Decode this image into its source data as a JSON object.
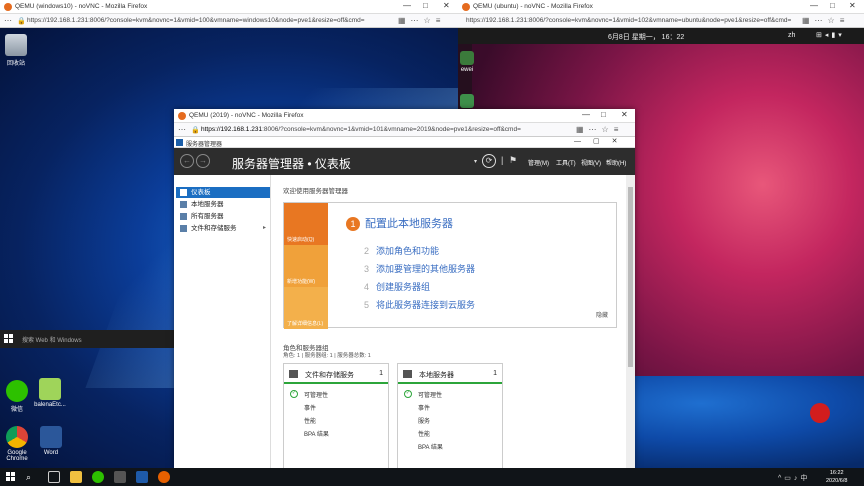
{
  "left_browser": {
    "title": "QEMU (windows10) - noVNC - Mozilla Firefox",
    "url": "https://192.168.1.231:8006/?console=kvm&novnc=1&vmid=100&vmname=windows10&node=pve1&resize=off&cmd="
  },
  "right_browser": {
    "title": "QEMU (ubuntu) - noVNC - Mozilla Firefox",
    "url": "https://192.168.1.231:8006/?console=kvm&novnc=1&vmid=102&vmname=ubuntu&node=pve1&resize=off&cmd="
  },
  "front_browser": {
    "title": "QEMU (2019) - noVNC - Mozilla Firefox",
    "url_host": "https://192.168.1.231",
    "url_rest": ":8006/?console=kvm&novnc=1&vmid=101&vmname=2019&node=pve1&resize=off&cmd="
  },
  "server_manager": {
    "window_title": "服务器管理器",
    "header_title": "服务器管理器 • 仪表板",
    "menus": {
      "manage": "管理(M)",
      "tools": "工具(T)",
      "view": "视图(V)",
      "help": "帮助(H)"
    },
    "nav": [
      {
        "label": "仪表板"
      },
      {
        "label": "本地服务器"
      },
      {
        "label": "所有服务器"
      },
      {
        "label": "文件和存储服务",
        "arrow": "▸"
      }
    ],
    "welcome": "欢迎使用服务器管理器",
    "tiles": [
      "快速启动(Q)",
      "新增功能(W)",
      "了解详细信息(L)"
    ],
    "step1": {
      "num": "1",
      "label": "配置此本地服务器"
    },
    "steps": [
      {
        "num": "2",
        "label": "添加角色和功能"
      },
      {
        "num": "3",
        "label": "添加要管理的其他服务器"
      },
      {
        "num": "4",
        "label": "创建服务器组"
      },
      {
        "num": "5",
        "label": "将此服务器连接到云服务"
      }
    ],
    "hide": "隐藏",
    "roles_title": "角色和服务器组",
    "roles_sub": "角色: 1 | 服务器组: 1 | 服务器总数: 1",
    "cards": [
      {
        "name": "文件和存储服务",
        "count": "1",
        "rows": [
          "可管理性",
          "事件",
          "性能",
          "BPA 结果"
        ]
      },
      {
        "name": "本地服务器",
        "count": "1",
        "rows": [
          "可管理性",
          "事件",
          "服务",
          "性能",
          "BPA 结果"
        ]
      }
    ]
  },
  "win_desktop": {
    "icons": [
      {
        "label": "回收站"
      },
      {
        "label": "微信"
      },
      {
        "label": "balenaEtc..."
      },
      {
        "label": "Google Chrome"
      },
      {
        "label": "Word"
      }
    ],
    "search_placeholder": "搜索 Web 和 Windows"
  },
  "ubuntu": {
    "clock": "6月8日 星期一， 16：22",
    "lang": "zh",
    "icon_label": "ewei"
  },
  "taskbar": {
    "time": "16:22",
    "date": "2020/6/8"
  },
  "colors": {
    "accent_orange": "#e87722",
    "ok_green": "#2ca53a",
    "sm_blue": "#1b6ec2"
  }
}
